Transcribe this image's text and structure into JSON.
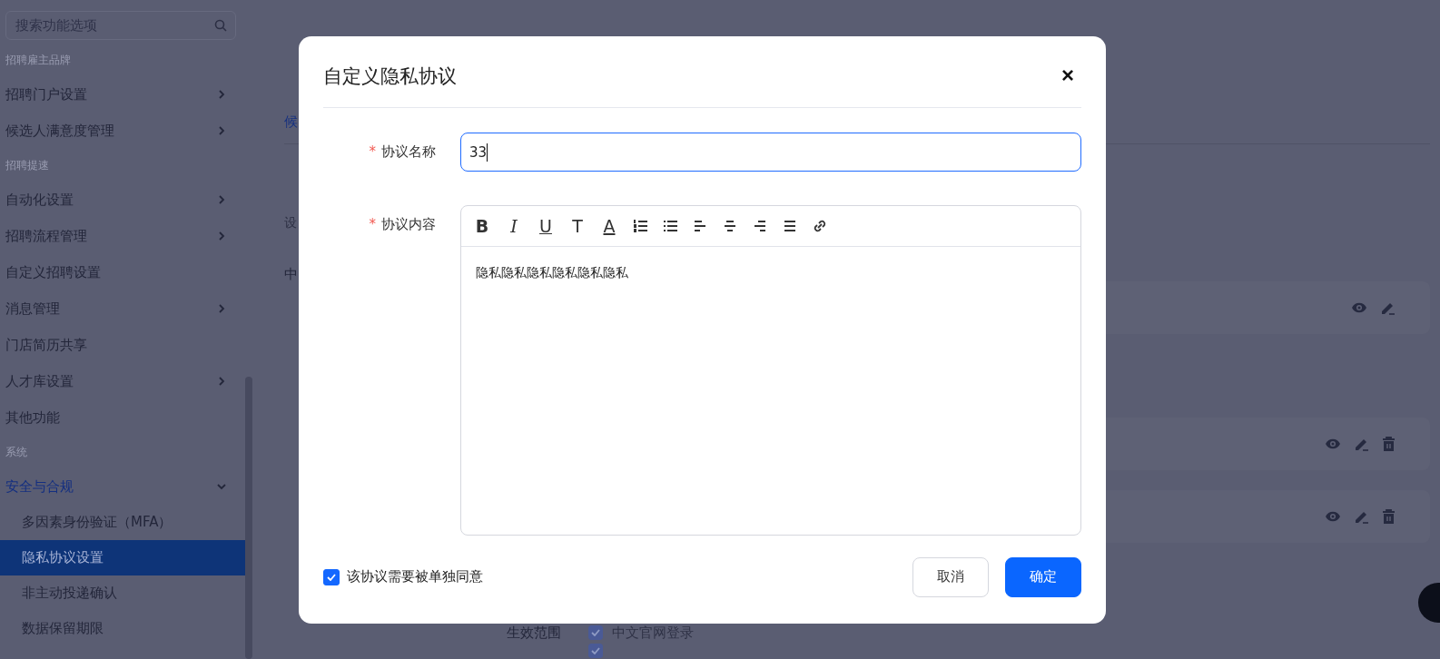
{
  "sidebar": {
    "search": {
      "placeholder": "搜索功能选项"
    },
    "sections": [
      {
        "heading": "招聘雇主品牌",
        "items": [
          {
            "label": "招聘门户设置",
            "kind": "submenu",
            "expanded": false
          },
          {
            "label": "候选人满意度管理",
            "kind": "submenu",
            "expanded": false
          }
        ]
      },
      {
        "heading": "招聘提速",
        "items": [
          {
            "label": "自动化设置",
            "kind": "submenu",
            "expanded": false
          },
          {
            "label": "招聘流程管理",
            "kind": "submenu",
            "expanded": false
          },
          {
            "label": "自定义招聘设置",
            "kind": "link"
          },
          {
            "label": "消息管理",
            "kind": "submenu",
            "expanded": false
          },
          {
            "label": "门店简历共享",
            "kind": "link"
          },
          {
            "label": "人才库设置",
            "kind": "submenu",
            "expanded": false
          },
          {
            "label": "其他功能",
            "kind": "link"
          }
        ]
      },
      {
        "heading": "系统",
        "items": [
          {
            "label": "安全与合规",
            "kind": "submenu",
            "expanded": true,
            "children": [
              {
                "label": "多因素身份验证（MFA）",
                "selected": false
              },
              {
                "label": "隐私协议设置",
                "selected": true
              },
              {
                "label": "非主动投递确认",
                "selected": false
              },
              {
                "label": "数据保留期限",
                "selected": false
              }
            ]
          }
        ]
      }
    ]
  },
  "main": {
    "tab": "候",
    "description": "设",
    "section_label": "中",
    "cards": [
      {
        "deletable": false
      },
      {
        "deletable": true
      },
      {
        "deletable": true
      }
    ],
    "scope": {
      "label": "生效范围",
      "options": [
        {
          "label": "中文官网登录",
          "checked": true
        },
        {
          "checked": true
        }
      ]
    }
  },
  "dialog": {
    "title": "自定义隐私协议",
    "close": "×",
    "name_field": {
      "label": "协议名称",
      "required_mark": "*",
      "value": "33"
    },
    "content_field": {
      "label": "协议内容",
      "required_mark": "*",
      "value": "隐私隐私隐私隐私隐私隐私",
      "toolbar": [
        {
          "kind": "bold",
          "label": "B"
        },
        {
          "kind": "italic",
          "label": "I"
        },
        {
          "kind": "underline",
          "label": "U"
        },
        {
          "kind": "clear",
          "label": "T"
        },
        {
          "kind": "color",
          "label": "A"
        },
        {
          "kind": "ordered-list"
        },
        {
          "kind": "bullet-list"
        },
        {
          "kind": "align-left"
        },
        {
          "kind": "align-center"
        },
        {
          "kind": "align-right"
        },
        {
          "kind": "justify"
        },
        {
          "kind": "link"
        }
      ]
    },
    "consent": {
      "label": "该协议需要被单独同意",
      "checked": true
    },
    "buttons": [
      {
        "label": "取消",
        "kind": "secondary"
      },
      {
        "label": "确定",
        "kind": "primary"
      }
    ]
  }
}
